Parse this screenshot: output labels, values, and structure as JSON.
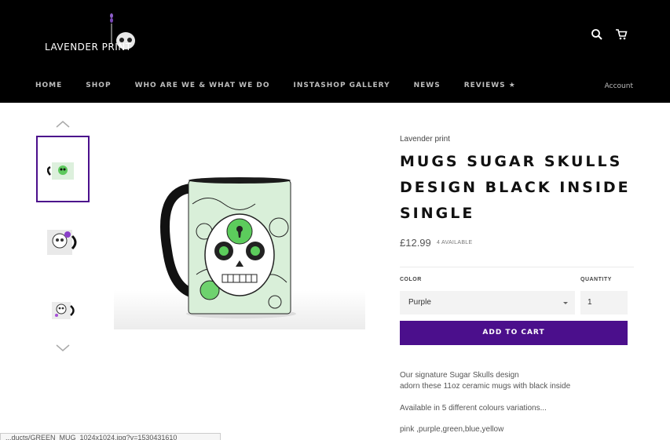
{
  "header": {
    "logo_text": "LAVENDER PRINT",
    "nav": [
      "HOME",
      "SHOP",
      "WHO ARE WE & WHAT WE DO",
      "INSTASHOP GALLERY",
      "NEWS",
      "REVIEWS ★"
    ],
    "account_label": "Account",
    "icons": {
      "search": "search-icon",
      "cart": "cart-icon"
    }
  },
  "gallery": {
    "icons": {
      "up": "chevron-up-icon",
      "down": "chevron-down-icon"
    }
  },
  "product": {
    "vendor": "Lavender print",
    "title": "MUGS SUGAR SKULLS DESIGN BLACK INSIDE SINGLE",
    "price": "£12.99",
    "stock": "4 AVAILABLE",
    "color_label": "COLOR",
    "color_value": "Purple",
    "quantity_label": "QUANTITY",
    "quantity_value": "1",
    "add_to_cart": "ADD TO CART",
    "description": [
      "Our signature Sugar Skulls design",
      "adorn these 11oz ceramic mugs with black inside",
      "Available in 5 different colours variations...",
      "pink ,purple,green,blue,yellow"
    ]
  },
  "status_bar": {
    "url": "...ducts/GREEN_MUG_1024x1024.jpg?v=1530431610"
  },
  "colors": {
    "accent": "#4b0f8c",
    "header_bg": "#000000"
  }
}
